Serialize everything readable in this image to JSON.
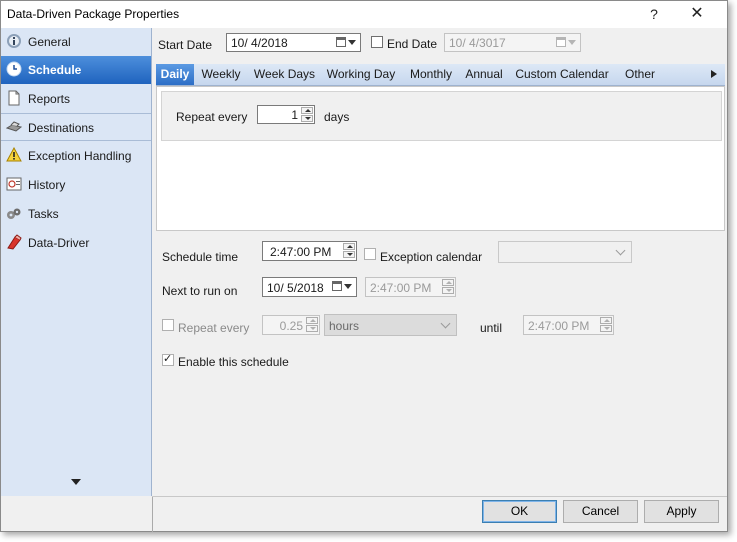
{
  "window": {
    "title": "Data-Driven Package Properties",
    "help_glyph": "?",
    "close_glyph": "✕"
  },
  "sidebar": {
    "items": [
      {
        "label": "General",
        "icon": "info-icon",
        "selected": false
      },
      {
        "label": "Schedule",
        "icon": "clock-icon",
        "selected": true
      },
      {
        "label": "Reports",
        "icon": "report-page-icon",
        "selected": false
      },
      {
        "label": "Destinations",
        "icon": "printer-icon",
        "selected": false
      },
      {
        "label": "Exception Handling",
        "icon": "warning-icon",
        "selected": false
      },
      {
        "label": "History",
        "icon": "history-icon",
        "selected": false
      },
      {
        "label": "Tasks",
        "icon": "tasks-icon",
        "selected": false
      },
      {
        "label": "Data-Driver",
        "icon": "data-driver-icon",
        "selected": false
      }
    ]
  },
  "dates": {
    "start_label": "Start Date",
    "start_value": "10/ 4/2018",
    "end_label": "End Date",
    "end_value": "10/ 4/3017",
    "end_checked": false
  },
  "tabs": [
    "Daily",
    "Weekly",
    "Week Days",
    "Working Day",
    "Monthly",
    "Annual",
    "Custom Calendar",
    "Other"
  ],
  "selected_tab": "Daily",
  "daily": {
    "repeat_label": "Repeat every",
    "repeat_value": "1",
    "unit": "days"
  },
  "schedule": {
    "time_label": "Schedule time",
    "time_value": "2:47:00 PM",
    "exception_label": "Exception calendar",
    "exception_checked": false,
    "exception_value": "",
    "next_label": "Next to run on",
    "next_date": "10/ 5/2018",
    "next_time": "2:47:00 PM",
    "repeat_label": "Repeat every",
    "repeat_checked": false,
    "repeat_value": "0.25",
    "repeat_unit": "hours",
    "until_label": "until",
    "until_value": "2:47:00 PM",
    "enable_label": "Enable this schedule",
    "enable_checked": true
  },
  "buttons": {
    "ok": "OK",
    "cancel": "Cancel",
    "apply": "Apply"
  }
}
